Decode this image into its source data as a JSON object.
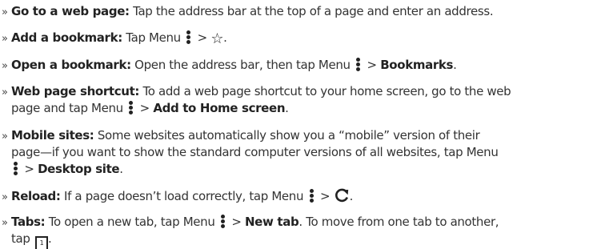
{
  "items": [
    {
      "title": "Go to a web page:",
      "text": " Tap the address bar at the top of a page and enter an address."
    },
    {
      "title": "Add a bookmark:",
      "text": " Tap Menu",
      "gt": " > ",
      "end": "."
    },
    {
      "title": "Open a bookmark:",
      "text": " Open the address bar, then tap Menu",
      "gt": " > ",
      "target": "Bookmarks",
      "end": "."
    },
    {
      "title": "Web page shortcut:",
      "text_line1": " To add a web page shortcut to your home screen, go to the web",
      "text_line2": "page and tap Menu",
      "gt": " > ",
      "target": "Add to Home screen",
      "end": "."
    },
    {
      "title": "Mobile sites:",
      "text_line1": " Some websites automatically show you a “mobile” version of their",
      "text_line2": "page—if you want to show the standard computer versions of all websites, tap Menu",
      "gt": " > ",
      "target": "Desktop site",
      "end": "."
    },
    {
      "title": "Reload:",
      "text": " If a page doesn’t load correctly, tap Menu",
      "gt": " > ",
      "end": "."
    },
    {
      "title": "Tabs:",
      "text_line1a": " To open a new tab, tap Menu",
      "gt": " > ",
      "target": "New tab",
      "text_line1b": ". To move from one tab to another,",
      "text_line2": "tap",
      "tab_count": "1",
      "end": "."
    }
  ],
  "bullet": "»",
  "icons": {
    "menu": "menu-dots-icon",
    "star": "star-outline-icon",
    "reload": "reload-icon",
    "tab": "tab-icon"
  }
}
